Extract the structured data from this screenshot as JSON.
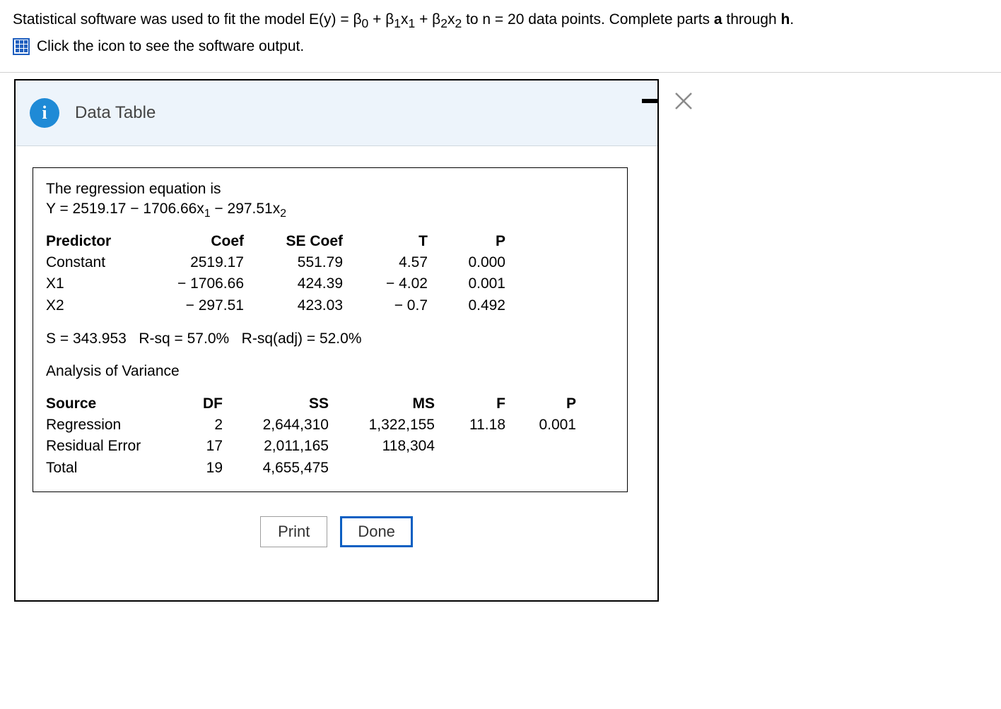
{
  "question": {
    "prefix": "Statistical software was used to fit the model E(y) = β",
    "s0": "0",
    "plus1": " + β",
    "s1": "1",
    "x1a": "x",
    "x1b": "1",
    "plus2": " + β",
    "s2": "2",
    "x2a": "x",
    "x2b": "2",
    "suffix1": " to n = 20 data points. Complete parts ",
    "bold_a": "a",
    "suffix2": " through ",
    "bold_h": "h",
    "period": "."
  },
  "icon_link_text": "Click the icon to see the software output.",
  "dialog": {
    "title": "Data Table",
    "eq_label": "The regression equation is",
    "eq_prefix": "Y = 2519.17 − 1706.66x",
    "eq_s1": "1",
    "eq_mid": " − 297.51x",
    "eq_s2": "2",
    "predictor_headers": {
      "c0": "Predictor",
      "c1": "Coef",
      "c2": "SE Coef",
      "c3": "T",
      "c4": "P"
    },
    "predictors": [
      {
        "name": "Constant",
        "coef": "2519.17",
        "se": "551.79",
        "t": "4.57",
        "p": "0.000"
      },
      {
        "name": "X1",
        "coef": "− 1706.66",
        "se": "424.39",
        "t": "− 4.02",
        "p": "0.001"
      },
      {
        "name": "X2",
        "coef": "− 297.51",
        "se": "423.03",
        "t": "− 0.7",
        "p": "0.492"
      }
    ],
    "stats_line": "S = 343.953   R-sq = 57.0%   R-sq(adj) = 52.0%",
    "anova_title": "Analysis of Variance",
    "anova_headers": {
      "c0": "Source",
      "c1": "DF",
      "c2": "SS",
      "c3": "MS",
      "c4": "F",
      "c5": "P"
    },
    "anova_rows": [
      {
        "src": "Regression",
        "df": "2",
        "ss": "2,644,310",
        "ms": "1,322,155",
        "f": "11.18",
        "p": "0.001"
      },
      {
        "src": "Residual Error",
        "df": "17",
        "ss": "2,011,165",
        "ms": "118,304",
        "f": "",
        "p": ""
      },
      {
        "src": "Total",
        "df": "19",
        "ss": "4,655,475",
        "ms": "",
        "f": "",
        "p": ""
      }
    ],
    "buttons": {
      "print": "Print",
      "done": "Done"
    }
  }
}
